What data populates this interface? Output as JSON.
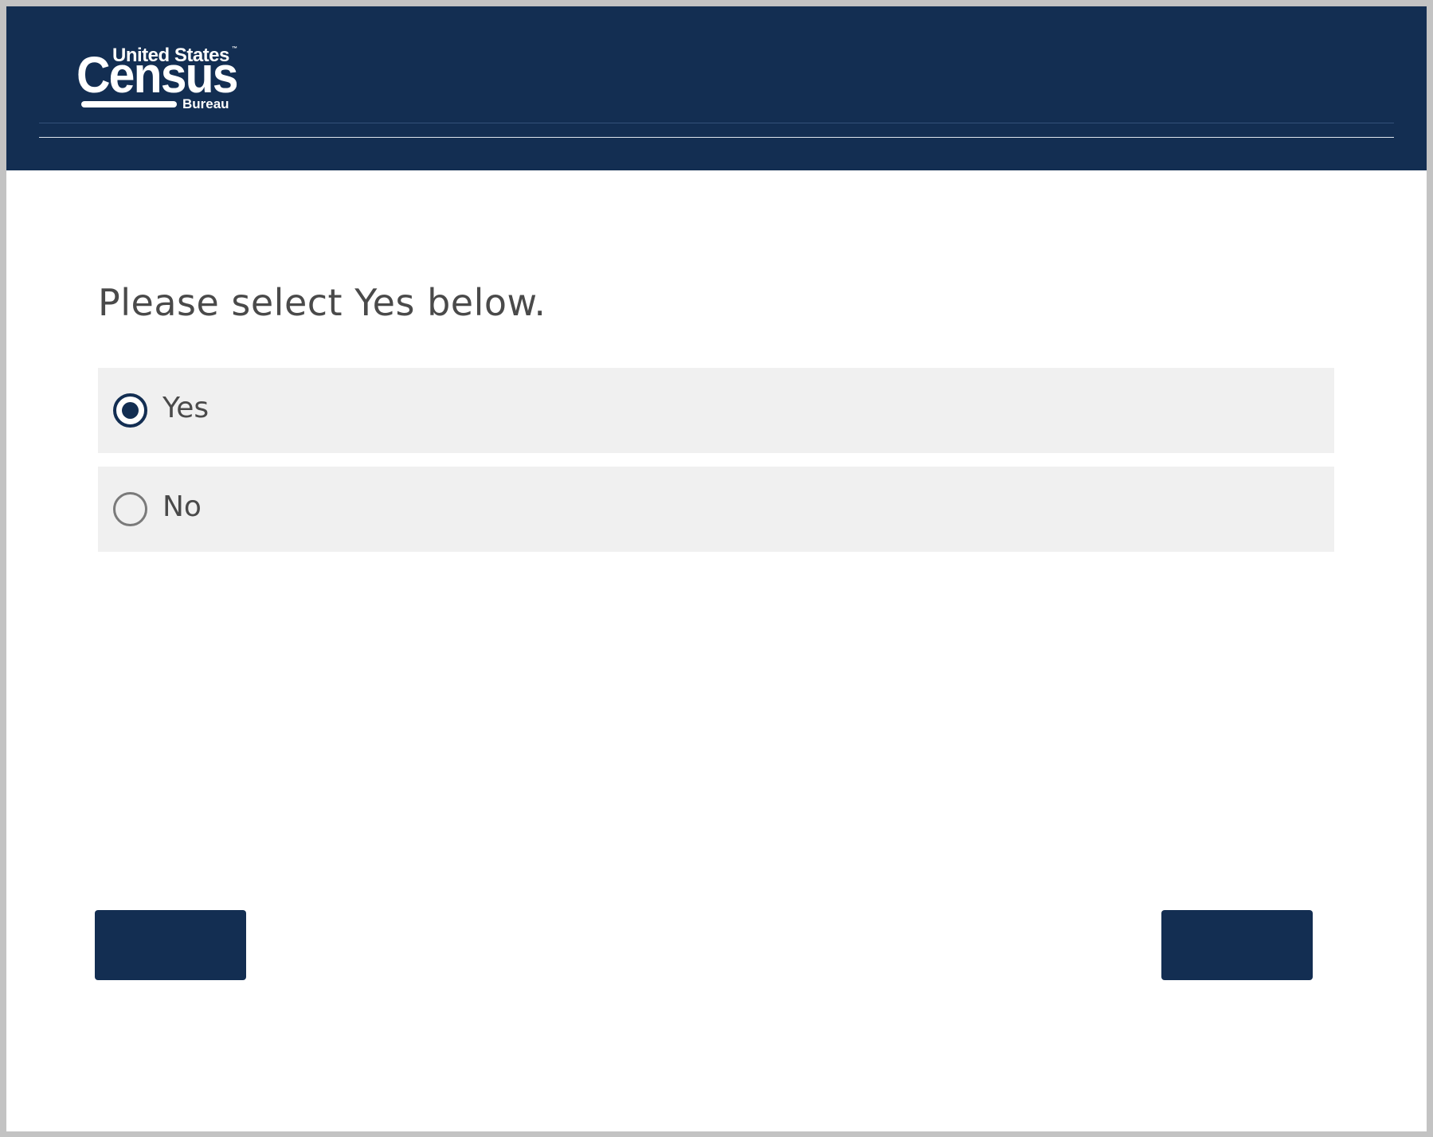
{
  "header": {
    "logo": {
      "line_top": "United States",
      "trademark": "™",
      "line_main": "Census",
      "line_bottom": "Bureau"
    }
  },
  "question": {
    "text": "Please select Yes below.",
    "options": [
      {
        "label": "Yes",
        "selected": true
      },
      {
        "label": "No",
        "selected": false
      }
    ]
  },
  "navigation": {
    "previous_label": "",
    "next_label": ""
  },
  "colors": {
    "brand_navy": "#132e52",
    "option_background": "#f0f0f0",
    "text": "#4a4a4a",
    "page_background": "#ffffff"
  }
}
